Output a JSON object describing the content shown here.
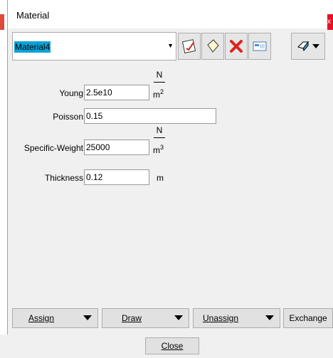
{
  "window": {
    "title": "Material",
    "close_glyph": "x"
  },
  "material_select": {
    "value": "Material4"
  },
  "toolbar": {
    "icons": [
      "edit-material-icon",
      "new-material-icon",
      "delete-icon",
      "properties-icon",
      "eraser-menu-icon"
    ]
  },
  "fields": {
    "young": {
      "label": "Young",
      "value": "2.5e10",
      "unit_num": "N",
      "unit_den": "m",
      "unit_exp": "2"
    },
    "poisson": {
      "label": "Poisson",
      "value": "0.15"
    },
    "specific_weight": {
      "label": "Specific-Weight",
      "value": "25000",
      "unit_num": "N",
      "unit_den": "m",
      "unit_exp": "3"
    },
    "thickness": {
      "label": "Thickness",
      "value": "0.12",
      "unit": "m"
    }
  },
  "bottom_buttons": {
    "assign": "Assign",
    "draw": "Draw",
    "unassign": "Unassign",
    "exchange": "Exchange"
  },
  "close_button": "Close"
}
